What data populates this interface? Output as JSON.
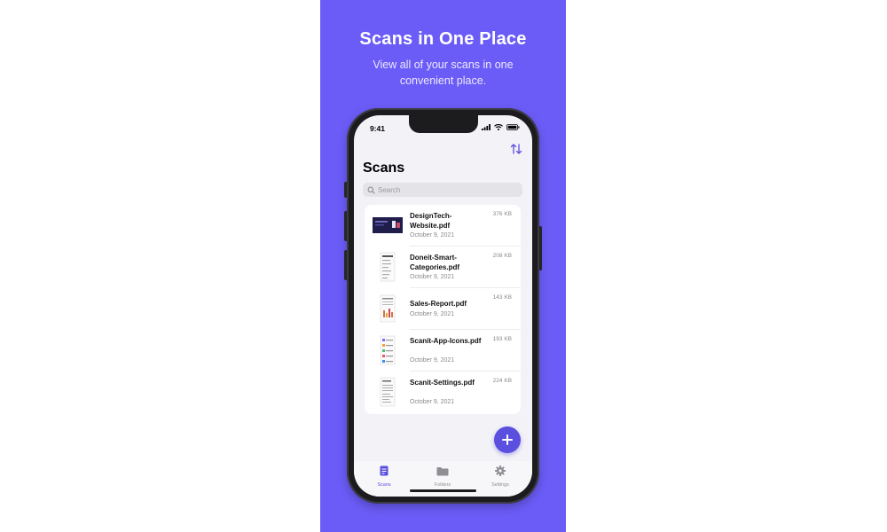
{
  "promo": {
    "title": "Scans in One Place",
    "subtitle": "View all of your scans in one convenient place."
  },
  "status_bar": {
    "time": "9:41"
  },
  "screen": {
    "title": "Scans",
    "search_placeholder": "Search"
  },
  "files": [
    {
      "name": "DesignTech-Website.pdf",
      "date": "October 9, 2021",
      "size": "376 KB"
    },
    {
      "name": "Doneit-Smart-Categories.pdf",
      "date": "October 9, 2021",
      "size": "208 KB"
    },
    {
      "name": "Sales-Report.pdf",
      "date": "October 9, 2021",
      "size": "143 KB"
    },
    {
      "name": "Scanit-App-Icons.pdf",
      "date": "October 9, 2021",
      "size": "193 KB"
    },
    {
      "name": "Scanit-Settings.pdf",
      "date": "October 9, 2021",
      "size": "224 KB"
    }
  ],
  "tabs": [
    {
      "label": "Scans",
      "icon": "document-icon",
      "active": true
    },
    {
      "label": "Folders",
      "icon": "folder-icon",
      "active": false
    },
    {
      "label": "Settings",
      "icon": "gear-icon",
      "active": false
    }
  ],
  "colors": {
    "promo_background": "#6b5cf7",
    "accent": "#5b4fe0"
  }
}
